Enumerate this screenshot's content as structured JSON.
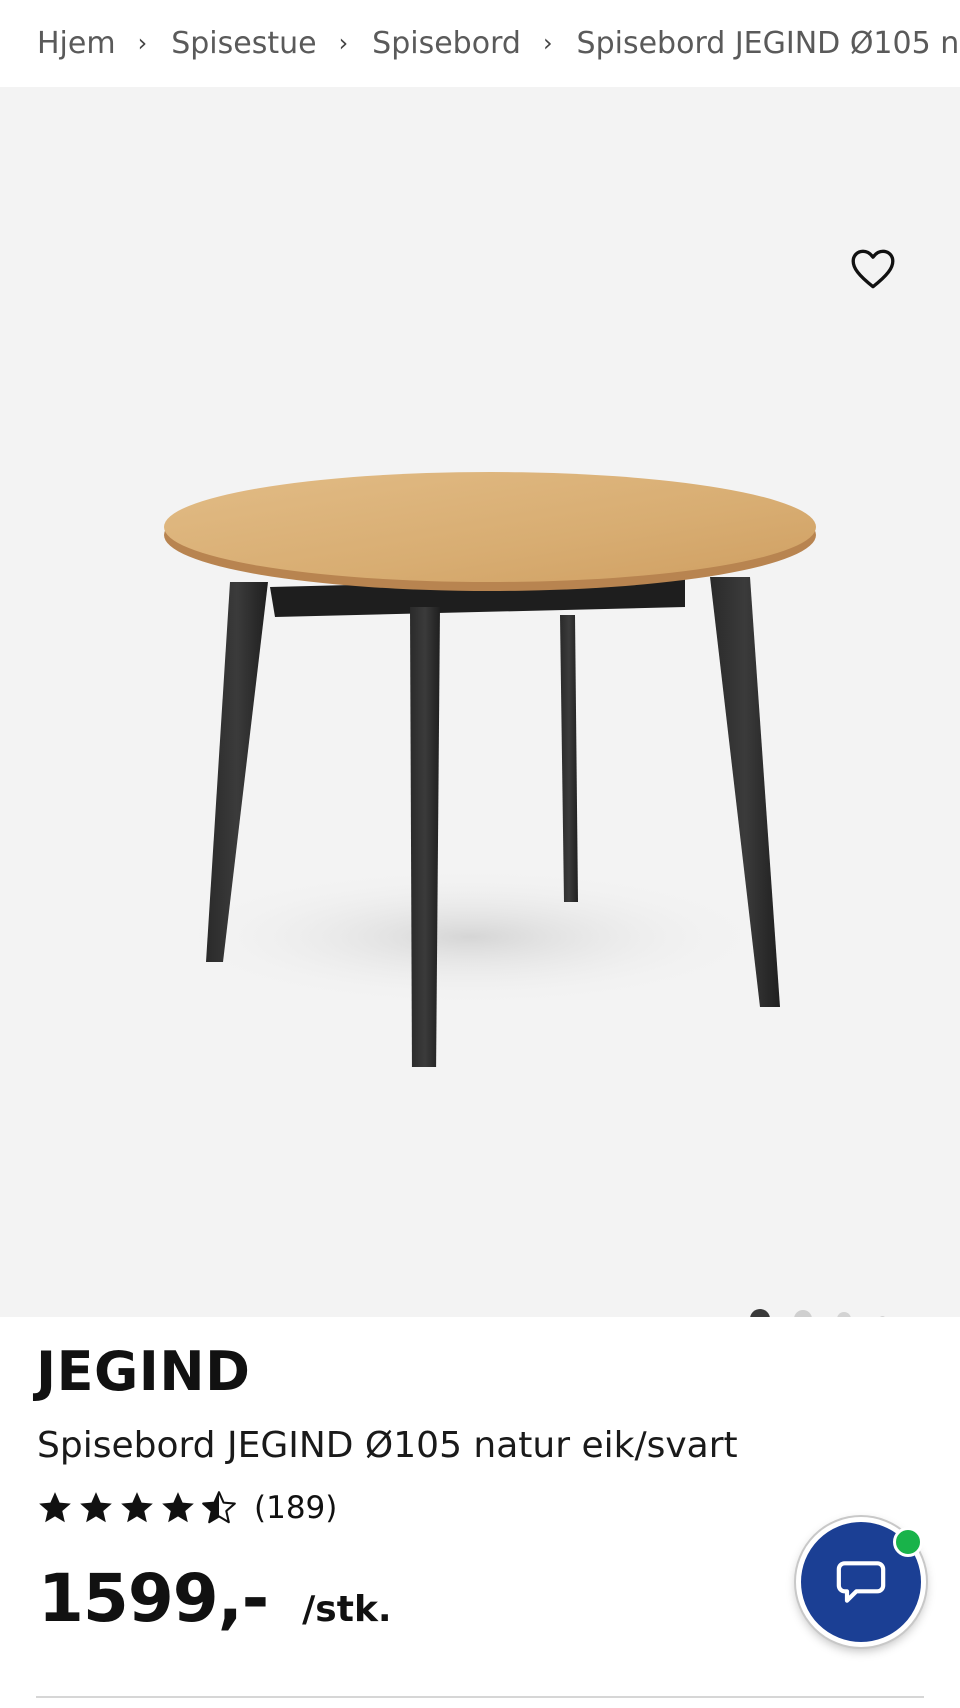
{
  "breadcrumb": {
    "items": [
      {
        "label": "Hjem"
      },
      {
        "label": "Spisestue"
      },
      {
        "label": "Spisebord"
      },
      {
        "label": "Spisebord JEGIND Ø105 natur eik/svart"
      }
    ],
    "separator": "›"
  },
  "gallery": {
    "favorite_icon": "heart-outline-icon",
    "image_alt": "Spisebord JEGIND Ø105 natur eik/svart",
    "image_count": 4,
    "active_index": 0
  },
  "product": {
    "brand": "JEGIND",
    "name": "Spisebord JEGIND Ø105 natur eik/svart",
    "rating": 4.5,
    "rating_max": 5,
    "review_count": "(189)",
    "price": "1599,-",
    "unit": "/stk."
  },
  "chat": {
    "icon": "chat-bubble-icon",
    "status": "online",
    "status_color": "#19b34a",
    "button_color": "#1b3f94"
  }
}
